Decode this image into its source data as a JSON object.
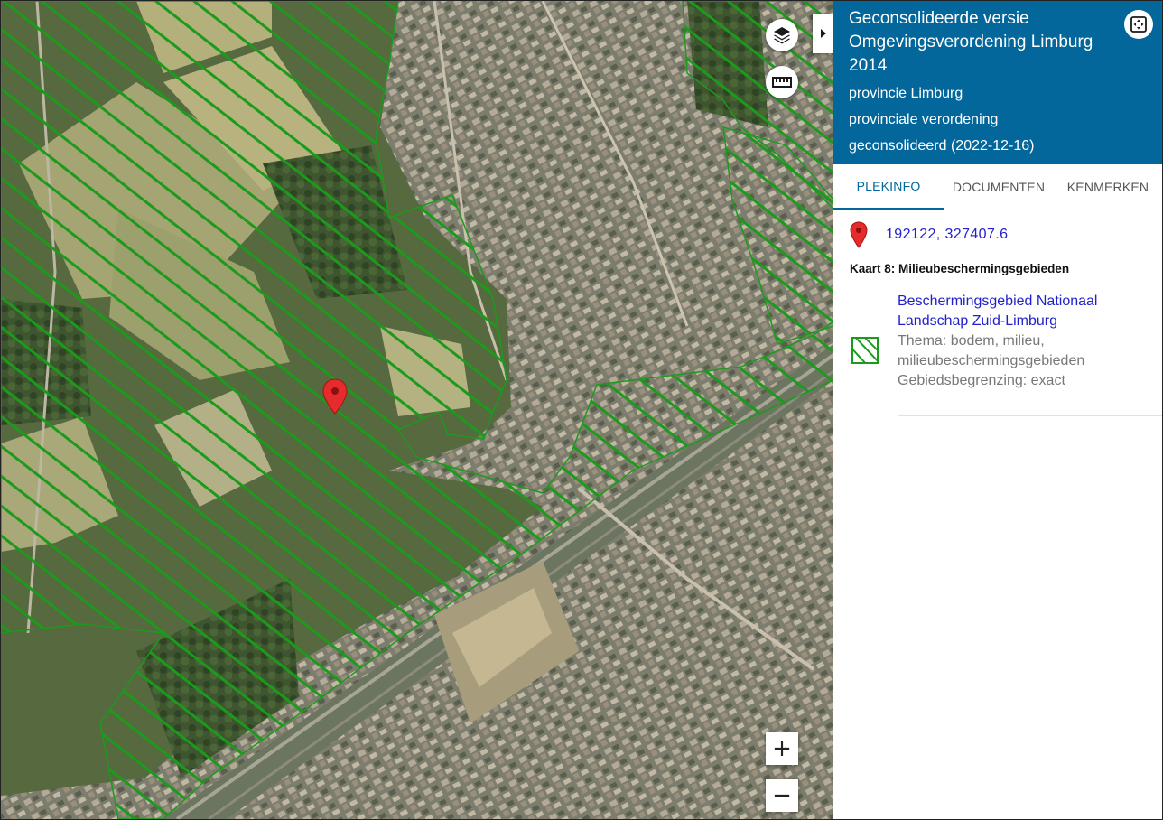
{
  "panel": {
    "title_line1": "Geconsolideerde versie",
    "title_line2": "Omgevingsverordening Limburg",
    "title_line3": "2014",
    "authority": "provincie Limburg",
    "type": "provinciale verordening",
    "status": "geconsolideerd (2022-12-16)",
    "tabs": [
      {
        "label": "PLEKINFO",
        "active": true
      },
      {
        "label": "DOCUMENTEN",
        "active": false
      },
      {
        "label": "KENMERKEN",
        "active": false
      }
    ],
    "coordinates": "192122, 327407.6",
    "section_title": "Kaart 8: Milieubeschermingsgebieden",
    "feature": {
      "name_line1": "Beschermingsgebied Nationaal",
      "name_line2": "Landschap Zuid-Limburg",
      "thema_line1": "Thema: bodem, milieu,",
      "thema_line2": "milieubeschermingsgebieden",
      "boundary": "Gebiedsbegrenzing: exact"
    }
  },
  "map_controls": {
    "zoom_in": "+",
    "zoom_out": "−",
    "layers_icon": "layers-icon",
    "ruler_icon": "ruler-icon",
    "collapse_icon": "caret-right-icon",
    "fullscreen_icon": "fullscreen-icon"
  },
  "colors": {
    "header": "#03679b",
    "hatch": "#1c9a1c",
    "pin": "#e52b2b",
    "link": "#2222cc"
  }
}
